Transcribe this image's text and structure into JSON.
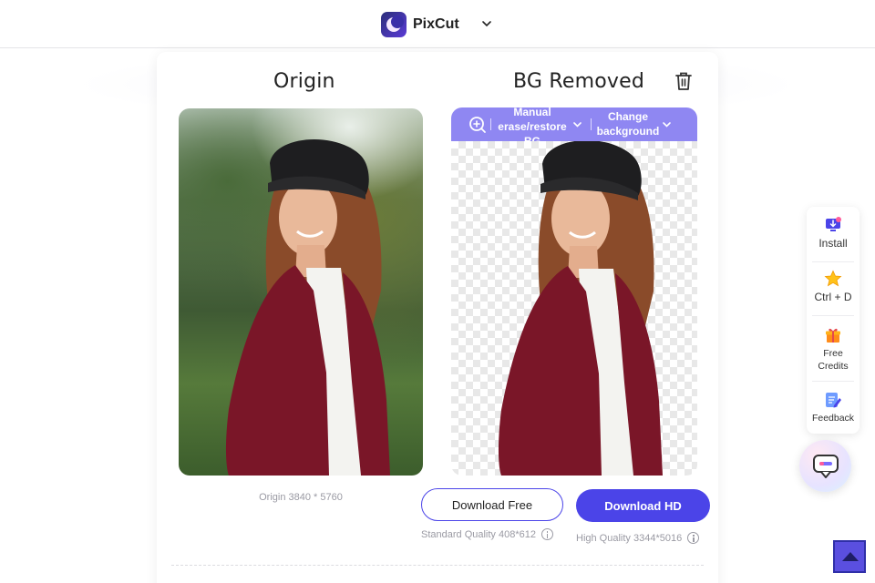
{
  "header": {
    "app_name": "PixCut"
  },
  "columns": {
    "origin_title": "Origin",
    "removed_title": "BG Removed"
  },
  "toolbar": {
    "manual_line1": "Manual",
    "manual_line2": "erase/restore",
    "manual_line3": "BG",
    "change_line1": "Change",
    "change_line2": "background"
  },
  "origin_caption": "Origin 3840 * 5760",
  "buttons": {
    "download_free": "Download Free",
    "download_hd": "Download HD"
  },
  "quality": {
    "standard": "Standard Quality 408*612",
    "high": "High Quality 3344*5016"
  },
  "side_panel": {
    "install": "Install",
    "bookmark": "Ctrl + D",
    "credits_line1": "Free",
    "credits_line2": "Credits",
    "feedback": "Feedback"
  },
  "colors": {
    "accent": "#4b44e8",
    "toolbar": "#8f87f2"
  }
}
